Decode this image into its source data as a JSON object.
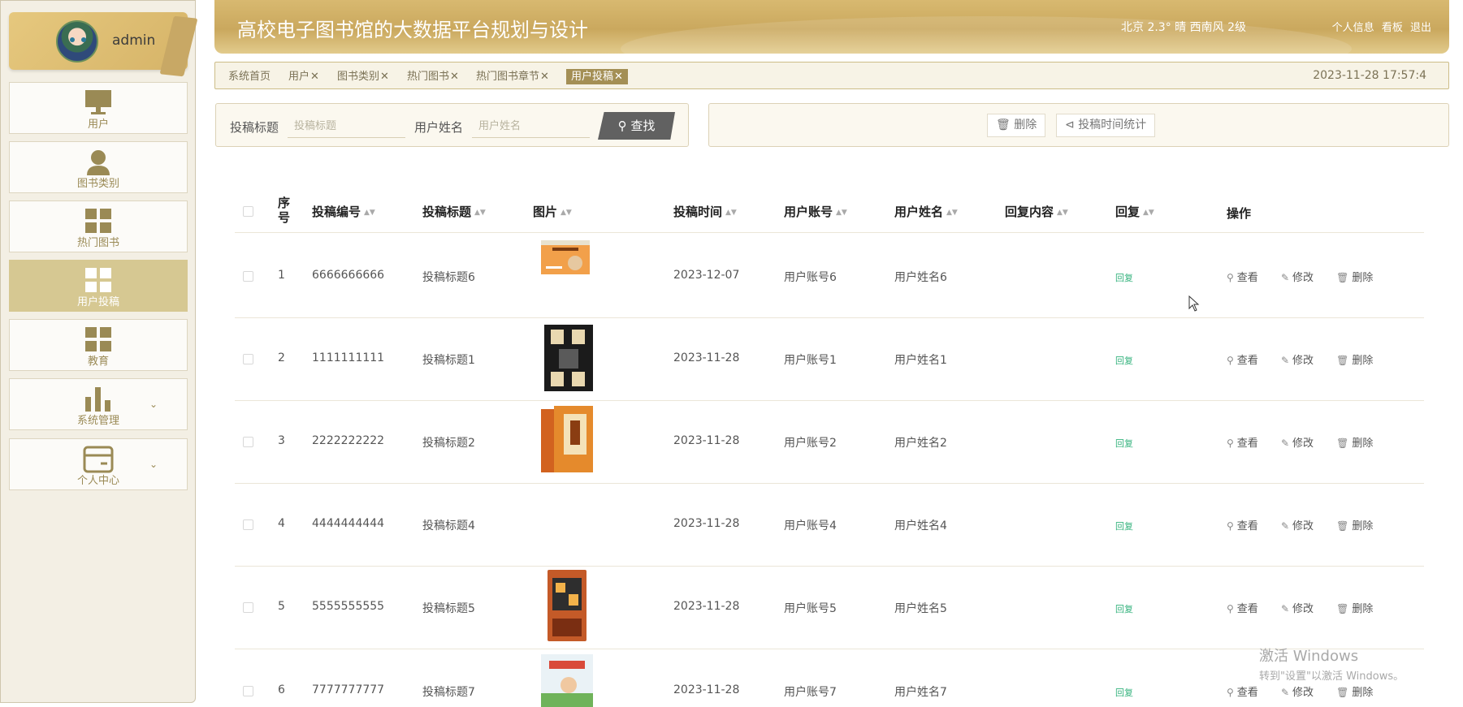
{
  "sidebar": {
    "user_name": "admin",
    "items": [
      {
        "label": "用户",
        "icon": "monitor-icon",
        "active": false
      },
      {
        "label": "图书类别",
        "icon": "person-icon",
        "active": false
      },
      {
        "label": "热门图书",
        "icon": "grid-icon",
        "active": false
      },
      {
        "label": "用户投稿",
        "icon": "grid-icon",
        "active": true
      },
      {
        "label": "教育",
        "icon": "grid-icon",
        "active": false
      },
      {
        "label": "系统管理",
        "icon": "bar-chart-icon",
        "active": false,
        "expandable": true
      },
      {
        "label": "个人中心",
        "icon": "card-icon",
        "active": false,
        "expandable": true
      }
    ]
  },
  "header": {
    "title": "高校电子图书馆的大数据平台规划与设计",
    "weather": "北京  2.3°  晴  西南风  2级",
    "links": [
      "个人信息",
      "看板",
      "退出"
    ]
  },
  "tabs": {
    "items": [
      "系统首页",
      "用户",
      "图书类别",
      "热门图书",
      "热门图书章节",
      "用户投稿"
    ],
    "active": "用户投稿",
    "datetime": "2023-11-28 17:57:4"
  },
  "search": {
    "title_label": "投稿标题",
    "title_placeholder": "投稿标题",
    "name_label": "用户姓名",
    "name_placeholder": "用户姓名",
    "button": "查找"
  },
  "actions": {
    "delete": "删除",
    "stats": "投稿时间统计"
  },
  "table": {
    "columns": [
      "序号",
      "投稿编号",
      "投稿标题",
      "图片",
      "投稿时间",
      "用户账号",
      "用户姓名",
      "回复内容",
      "回复",
      "操作"
    ],
    "rows": [
      {
        "no": "1",
        "id": "6666666666",
        "title": "投稿标题6",
        "has_image": true,
        "time": "2023-12-07",
        "account": "用户账号6",
        "name": "用户姓名6",
        "reply_content": "",
        "reply": "回复"
      },
      {
        "no": "2",
        "id": "1111111111",
        "title": "投稿标题1",
        "has_image": true,
        "time": "2023-11-28",
        "account": "用户账号1",
        "name": "用户姓名1",
        "reply_content": "",
        "reply": "回复"
      },
      {
        "no": "3",
        "id": "2222222222",
        "title": "投稿标题2",
        "has_image": true,
        "time": "2023-11-28",
        "account": "用户账号2",
        "name": "用户姓名2",
        "reply_content": "",
        "reply": "回复"
      },
      {
        "no": "4",
        "id": "4444444444",
        "title": "投稿标题4",
        "has_image": false,
        "time": "2023-11-28",
        "account": "用户账号4",
        "name": "用户姓名4",
        "reply_content": "",
        "reply": "回复"
      },
      {
        "no": "5",
        "id": "5555555555",
        "title": "投稿标题5",
        "has_image": true,
        "time": "2023-11-28",
        "account": "用户账号5",
        "name": "用户姓名5",
        "reply_content": "",
        "reply": "回复"
      },
      {
        "no": "6",
        "id": "7777777777",
        "title": "投稿标题7",
        "has_image": true,
        "time": "2023-11-28",
        "account": "用户账号7",
        "name": "用户姓名7",
        "reply_content": "",
        "reply": "回复"
      }
    ],
    "ops": {
      "view": "查看",
      "edit": "修改",
      "delete": "删除"
    }
  },
  "watermark": {
    "line1": "激活 Windows",
    "line2": "转到\"设置\"以激活 Windows。"
  }
}
